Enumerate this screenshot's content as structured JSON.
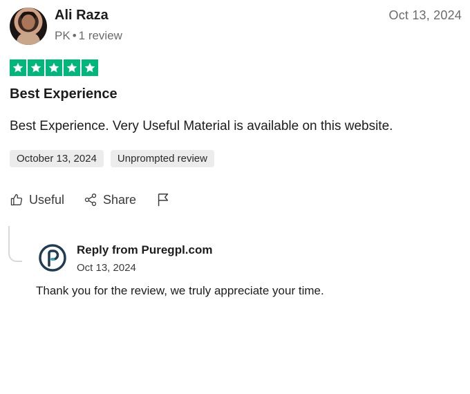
{
  "reviewer": {
    "name": "Ali Raza",
    "country": "PK",
    "separator": "•",
    "review_count": "1 review"
  },
  "review": {
    "date": "Oct 13, 2024",
    "rating": 5,
    "rating_max": 5,
    "title": "Best Experience",
    "body": "Best Experience. Very Useful Material is available on this website.",
    "tags": [
      "October 13, 2024",
      "Unprompted review"
    ]
  },
  "actions": {
    "useful_label": "Useful",
    "share_label": "Share"
  },
  "reply": {
    "title": "Reply from Puregpl.com",
    "date": "Oct 13, 2024",
    "text": "Thank you for the review, we truly appreciate your time."
  },
  "colors": {
    "star_green": "#00b67a",
    "tag_bg": "#ececec",
    "logo_ring": "#1f3c52",
    "logo_accent": "#25a7c7"
  },
  "icons": [
    "avatar-photo",
    "star-icon",
    "thumbs-up-icon",
    "share-icon",
    "flag-icon",
    "puregpl-logo-icon"
  ]
}
